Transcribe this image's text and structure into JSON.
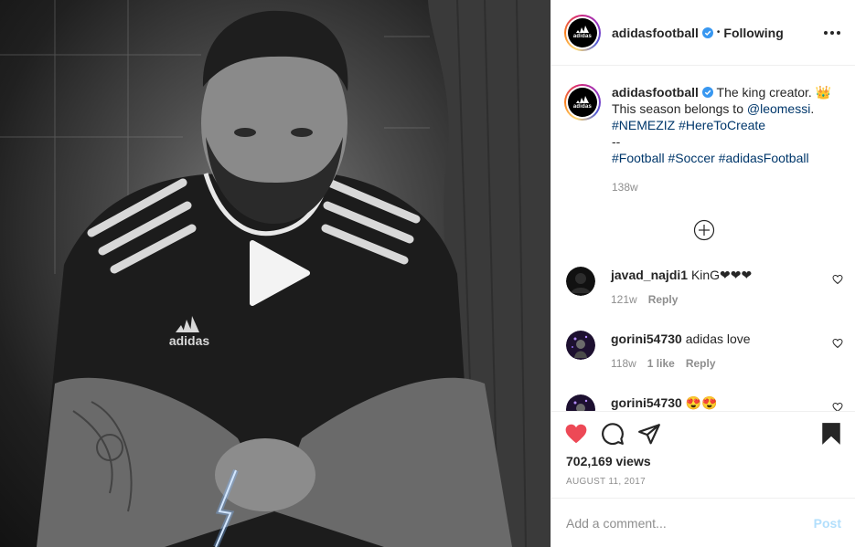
{
  "media": {
    "brand_text": "adidas"
  },
  "header": {
    "username": "adidasfootball",
    "follow_state": "Following"
  },
  "avatar": {
    "logo_text": "adidas"
  },
  "caption": {
    "username": "adidasfootball",
    "text_1": "The king creator. 👑",
    "text_2a": "This season belongs to ",
    "mention": "@leomessi",
    "text_2b": ".",
    "tag_nemeziz": "#NEMEZIZ",
    "tag_heretocreate": "#HereToCreate",
    "separator": "--",
    "tag_football": "#Football",
    "tag_soccer": "#Soccer",
    "tag_adidasfootball": "#adidasFootball",
    "time": "138w"
  },
  "comments": [
    {
      "username": "javad_najdi1",
      "text": "KinG❤❤❤",
      "time": "121w",
      "likes": "",
      "reply": "Reply"
    },
    {
      "username": "gorini54730",
      "text": "adidas love",
      "time": "118w",
      "likes": "1 like",
      "reply": "Reply"
    },
    {
      "username": "gorini54730",
      "text": "😍😍"
    }
  ],
  "stats": {
    "views": "702,169 views",
    "date": "AUGUST 11, 2017"
  },
  "composer": {
    "placeholder": "Add a comment...",
    "post_label": "Post"
  },
  "colors": {
    "like": "#ed4956",
    "link": "#00376b",
    "post_disabled": "#b2dffc",
    "verified": "#3897f0"
  }
}
